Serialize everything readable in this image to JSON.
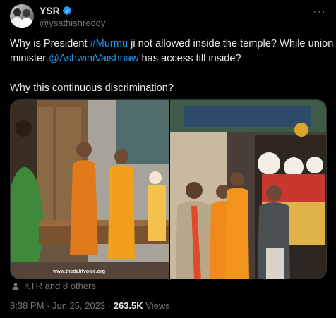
{
  "author": {
    "name": "YSR",
    "handle": "@ysathishreddy",
    "verified": true,
    "verified_color": "#1d9bf0"
  },
  "tweet": {
    "line1_a": "Why is President ",
    "line1_link": "#Murmu",
    "line1_b": " ji not allowed inside the temple? While union",
    "line2_a": "minister ",
    "line2_link": "@AshwiniVaishnaw",
    "line2_b": " has access till inside?",
    "line3": "Why this continuous discrimination?"
  },
  "media": {
    "watermark": "www.thedalitvoice.org"
  },
  "tagged": {
    "icon": "person-icon",
    "text": "KTR and 8 others"
  },
  "meta": {
    "time": "8:38 PM",
    "sep1": " · ",
    "date": "Jun 25, 2023",
    "sep2": " · ",
    "views_count": "263.5K",
    "views_label": " Views"
  },
  "colors": {
    "link": "#1d9bf0",
    "muted": "#71767b",
    "text": "#e7e9ea",
    "background": "#000000"
  }
}
